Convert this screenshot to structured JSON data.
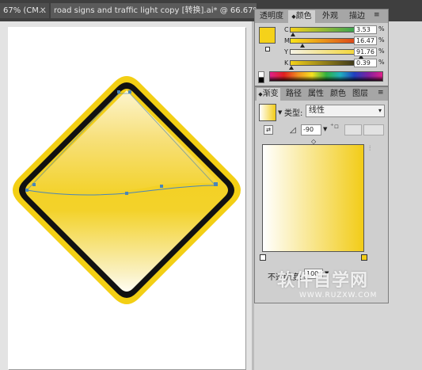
{
  "tabs": [
    {
      "label": "67% (CM..."
    },
    {
      "label": "road signs and traffic light copy [转换].ai* @ 66.67%"
    }
  ],
  "color_panel": {
    "tabs": [
      "透明度",
      "颜色",
      "外观",
      "描边"
    ],
    "swatch_color": "#f5d21a",
    "channels": [
      {
        "label": "C",
        "value": "3.53",
        "unit": "%"
      },
      {
        "label": "M",
        "value": "16.47",
        "unit": "%"
      },
      {
        "label": "Y",
        "value": "91.76",
        "unit": "%"
      },
      {
        "label": "K",
        "value": "0.39",
        "unit": "%"
      }
    ]
  },
  "gradient_panel": {
    "tabs": [
      "渐变",
      "路径",
      "属性",
      "颜色",
      "图层"
    ],
    "type_label": "类型:",
    "type_value": "线性",
    "angle_value": "-90",
    "opacity_label": "不透明度:",
    "opacity_value": "100",
    "start_color": "#ffffff",
    "end_color": "#f2cc18"
  },
  "watermark": {
    "text": "软件自学网",
    "url": "WWW.RUZXW.COM"
  },
  "colors": {
    "sign_yellow": "#f5d21a",
    "sign_border": "#111111",
    "path_blue": "#4a86b8"
  }
}
